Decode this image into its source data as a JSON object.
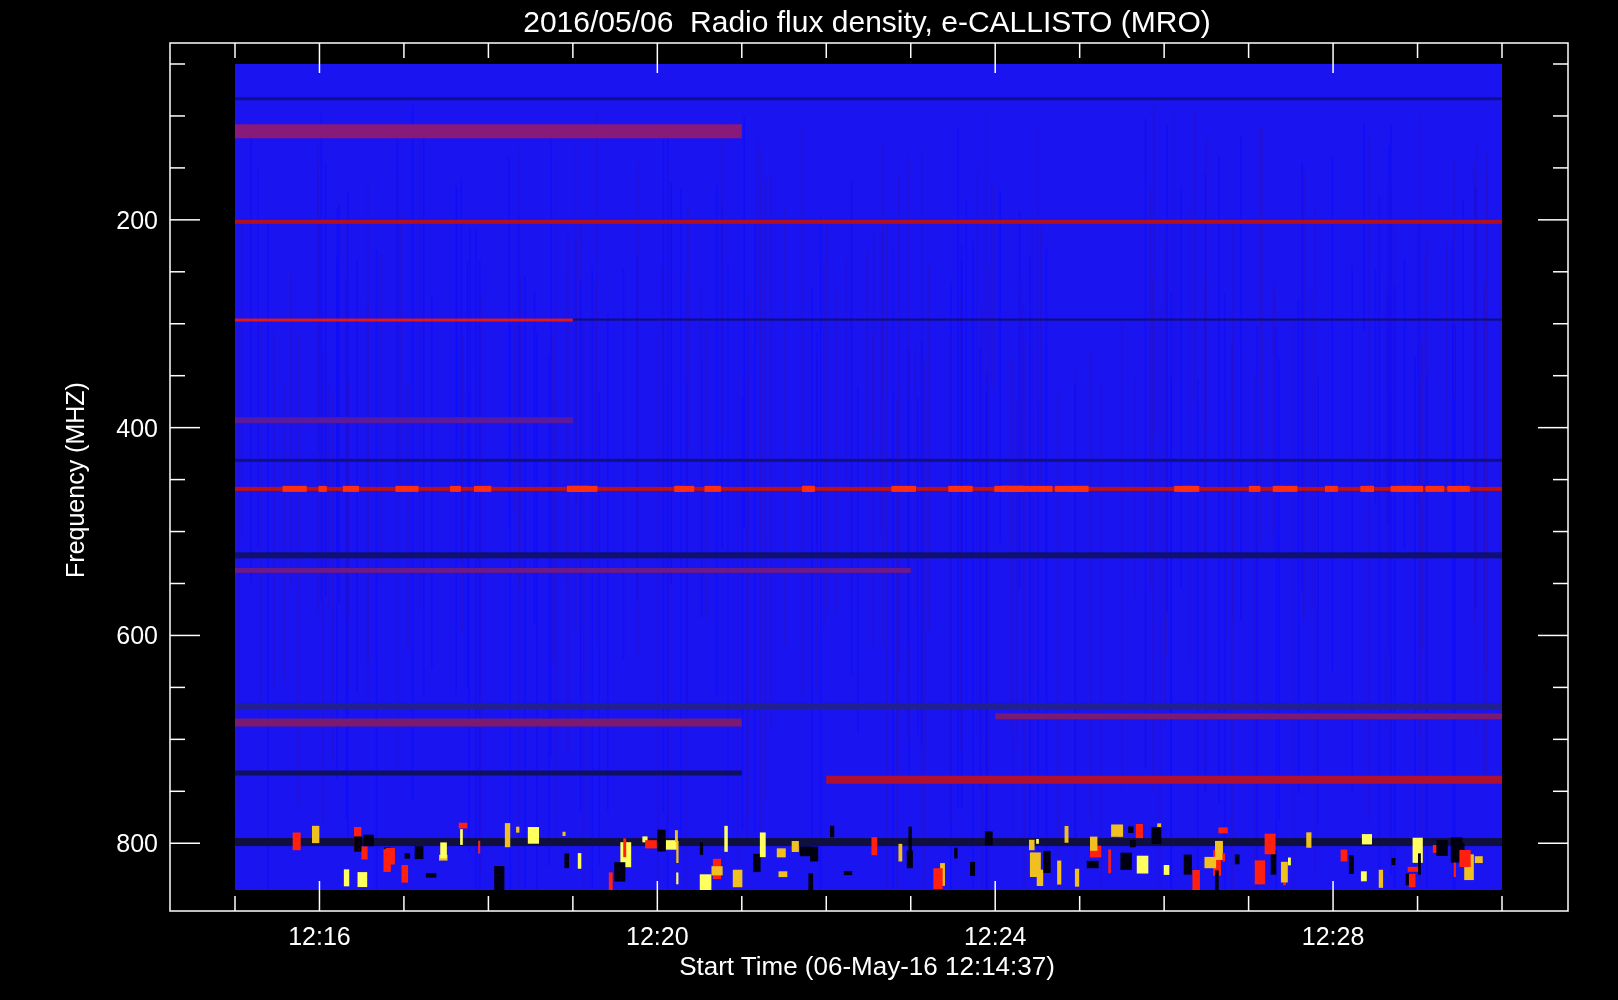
{
  "title": "2016/05/06  Radio flux density, e-CALLISTO (MRO)",
  "x_axis": {
    "label": "Start Time (06-May-16 12:14:37)",
    "ticks": [
      "12:16",
      "12:20",
      "12:24",
      "12:28"
    ]
  },
  "y_axis": {
    "label": "Frequency (MHZ)",
    "ticks": [
      "200",
      "400",
      "600",
      "800"
    ]
  }
}
